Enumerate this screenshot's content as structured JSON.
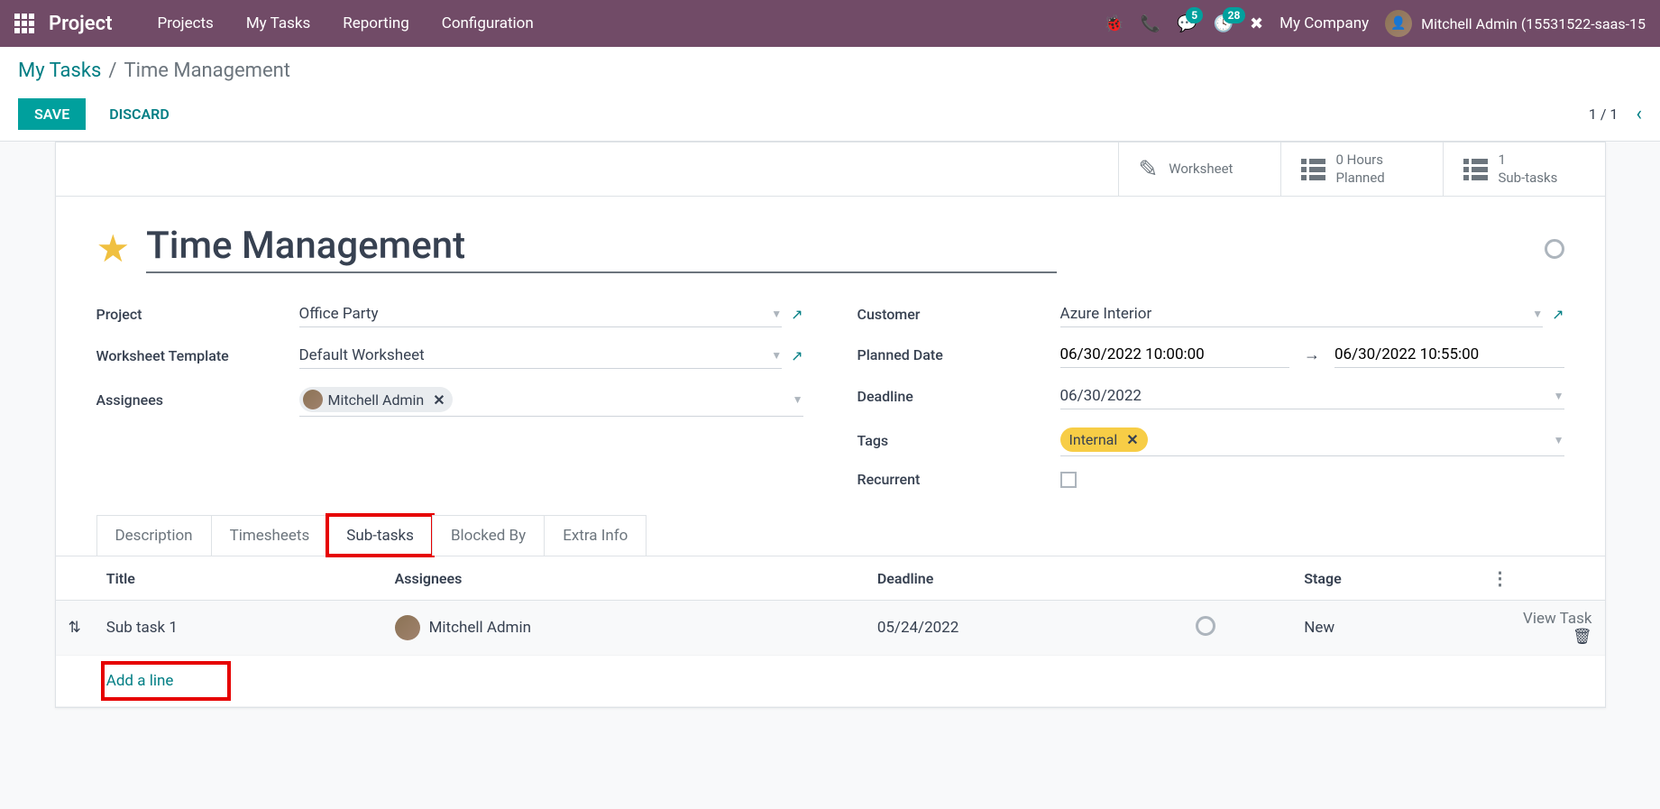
{
  "nav": {
    "brand": "Project",
    "items": [
      "Projects",
      "My Tasks",
      "Reporting",
      "Configuration"
    ],
    "messaging_count": "5",
    "activities_count": "28",
    "company": "My Company",
    "user": "Mitchell Admin (15531522-saas-15"
  },
  "breadcrumb": {
    "parent": "My Tasks",
    "current": "Time Management"
  },
  "buttons": {
    "save": "SAVE",
    "discard": "DISCARD"
  },
  "pager": "1 / 1",
  "stats": {
    "worksheet": "Worksheet",
    "hours_value": "0  Hours",
    "hours_label": "Planned",
    "subtasks_value": "1",
    "subtasks_label": "Sub-tasks"
  },
  "title": "Time Management",
  "fields": {
    "project_label": "Project",
    "project_value": "Office Party",
    "worksheet_label": "Worksheet Template",
    "worksheet_value": "Default Worksheet",
    "assignees_label": "Assignees",
    "assignees_value": "Mitchell Admin",
    "customer_label": "Customer",
    "customer_value": "Azure Interior",
    "planned_label": "Planned Date",
    "planned_start": "06/30/2022 10:00:00",
    "planned_end": "06/30/2022 10:55:00",
    "deadline_label": "Deadline",
    "deadline_value": "06/30/2022",
    "tags_label": "Tags",
    "tags_value": "Internal",
    "recurrent_label": "Recurrent"
  },
  "tabs": [
    "Description",
    "Timesheets",
    "Sub-tasks",
    "Blocked By",
    "Extra Info"
  ],
  "table": {
    "headers": {
      "title": "Title",
      "assignees": "Assignees",
      "deadline": "Deadline",
      "stage": "Stage"
    },
    "row": {
      "title": "Sub task 1",
      "assignee": "Mitchell Admin",
      "deadline": "05/24/2022",
      "stage": "New"
    },
    "view_task": "View Task",
    "add_line": "Add a line"
  }
}
